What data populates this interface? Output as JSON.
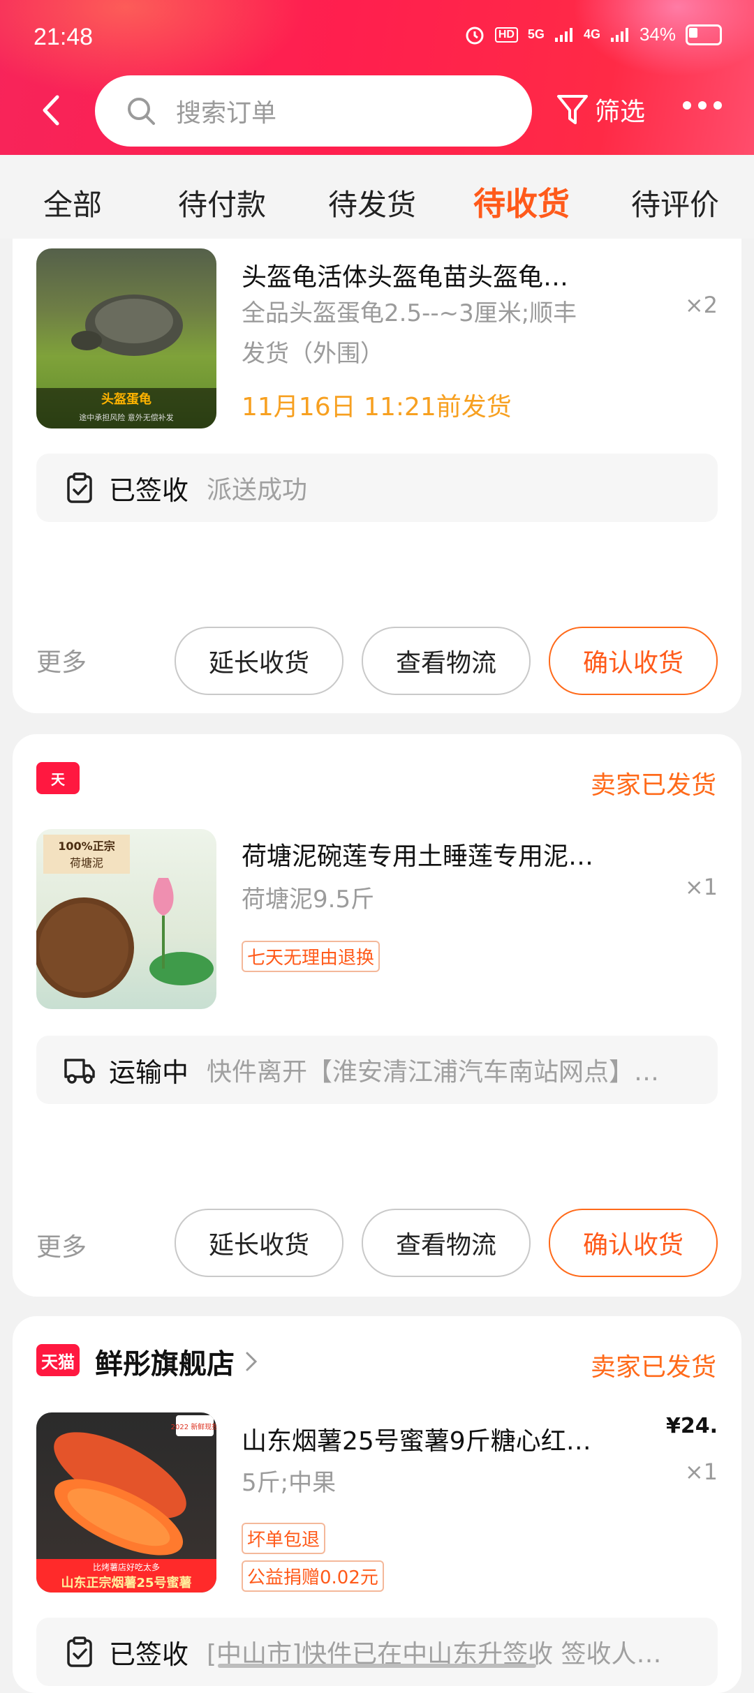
{
  "status_bar": {
    "time": "21:48",
    "network": "5G",
    "network2": "4G",
    "battery": "34%"
  },
  "header": {
    "search_placeholder": "搜索订单",
    "filter_label": "筛选"
  },
  "tabs": [
    "全部",
    "待付款",
    "待发货",
    "待收货",
    "待评价"
  ],
  "active_tab": "待收货",
  "orders": [
    {
      "title": "头盔龟活体头盔龟苗头盔龟…",
      "spec": "全品头盔蛋龟2.5--~3厘米;顺丰",
      "spec2": "发货（外围）",
      "qty": "×2",
      "ship_by": "11月16日 11:21前发货",
      "thumb_label": "头盔蛋龟",
      "thumb_sub": "途中承担风险  意外无偿补发",
      "status_label": "已签收",
      "status_detail": "派送成功",
      "more": "更多",
      "btn_extend": "延长收货",
      "btn_logistics": "查看物流",
      "btn_confirm": "确认收货"
    },
    {
      "shop_status": "卖家已发货",
      "title": "荷塘泥碗莲专用土睡莲专用泥…",
      "spec": "荷塘泥9.5斤",
      "qty": "×1",
      "tag": "七天无理由退换",
      "thumb_label1": "100%正宗",
      "thumb_label2": "荷塘泥",
      "status_label": "运输中",
      "status_detail": "快件离开【淮安清江浦汽车南站网点】…",
      "more": "更多",
      "btn_extend": "延长收货",
      "btn_logistics": "查看物流",
      "btn_confirm": "确认收货"
    },
    {
      "shop_badge": "天猫",
      "shop_name": "鲜彤旗舰店",
      "shop_status": "卖家已发货",
      "title": "山东烟薯25号蜜薯9斤糖心红…",
      "price": "¥24.",
      "spec": "5斤;中果",
      "qty": "×1",
      "tag1": "坏单包退",
      "tag2": "公益捐赠0.02元",
      "thumb_badge": "2022 新鲜现挖",
      "thumb_sub1": "比烤薯店好吃太多",
      "thumb_sub2": "山东正宗烟薯25号蜜薯",
      "status_label": "已签收",
      "status_detail": "[中山市]快件已在中山东升签收 签收人…"
    }
  ]
}
